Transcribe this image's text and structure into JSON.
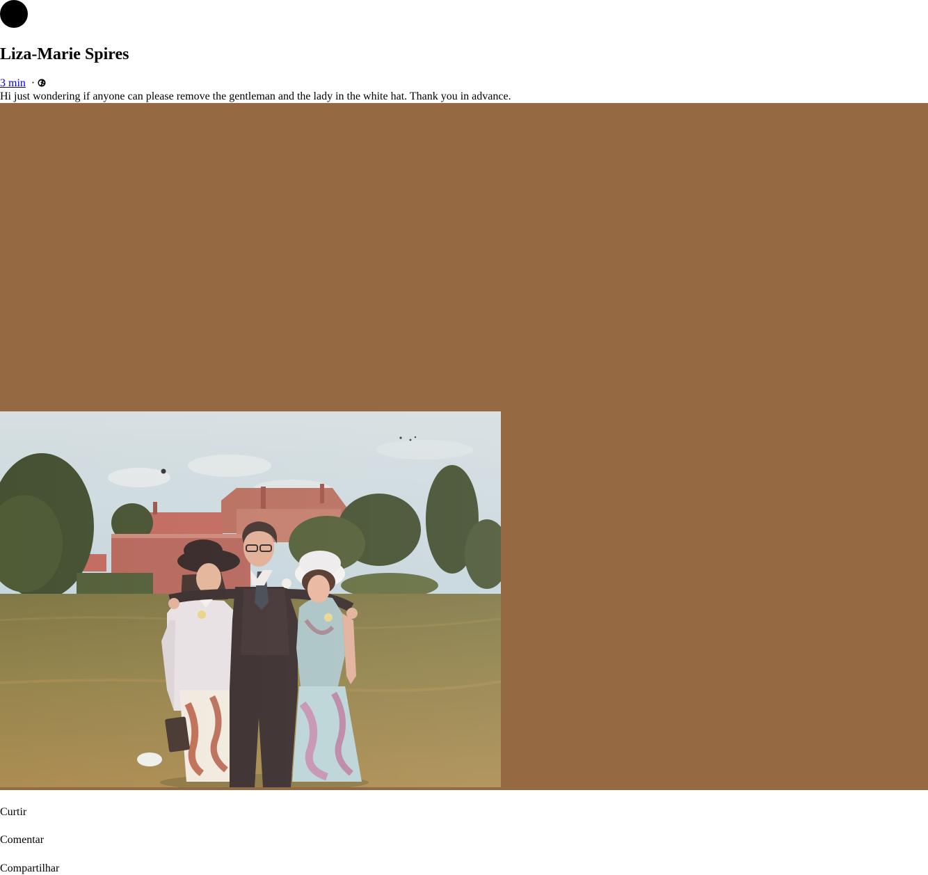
{
  "post": {
    "author": "Liza-Marie Spires",
    "timestamp": "3 min",
    "separator": "·",
    "audience_icon": "globe-icon",
    "text": "Hi just wondering if anyone can please remove the gentleman and the lady in the white hat. Thank you in advance."
  },
  "actions": {
    "like": "Curtir",
    "comment": "Comentar",
    "share": "Compartilhar"
  },
  "colors": {
    "photo_frame_background": "#956a42",
    "link": "#0000ee"
  }
}
